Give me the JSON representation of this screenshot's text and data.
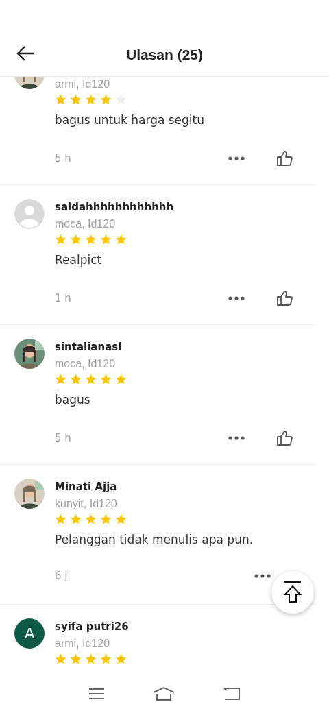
{
  "header": {
    "title": "Ulasan (25)"
  },
  "reviews": [
    {
      "variant": "armi, Id120",
      "stars": 4,
      "text": "bagus untuk harga segitu",
      "time": "5 h"
    },
    {
      "avatar": {
        "kind": "default"
      },
      "name": "saidahhhhhhhhhhhh",
      "variant": "moca, Id120",
      "stars": 5,
      "text": "Realpict",
      "time": "1 h"
    },
    {
      "name": "sintalianasl",
      "variant": "moca, Id120",
      "stars": 5,
      "text": "bagus",
      "time": "5 h"
    },
    {
      "name": "Minati Ajja",
      "variant": "kunyit, Id120",
      "stars": 5,
      "text": "Pelanggan tidak menulis apa pun.",
      "time": "6 j"
    },
    {
      "avatar": {
        "kind": "letter",
        "letter": "A"
      },
      "name": "syifa putri26",
      "variant": "armi, Id120",
      "stars": 5
    }
  ]
}
